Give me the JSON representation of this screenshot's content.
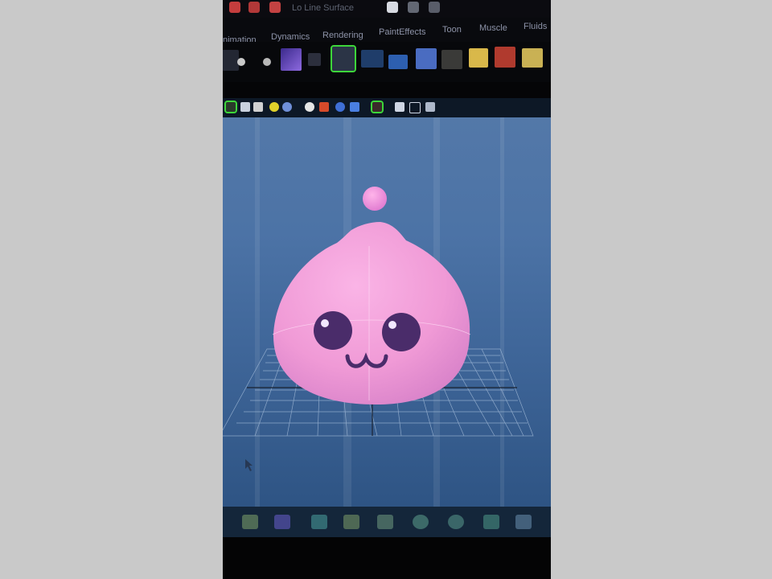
{
  "app": {
    "title": "Lo Line Surface"
  },
  "menu_tabs": [
    {
      "label": "nimation"
    },
    {
      "label": "Dynamics"
    },
    {
      "label": "Rendering"
    },
    {
      "label": "PaintEffects"
    },
    {
      "label": "Toon"
    },
    {
      "label": "Muscle"
    },
    {
      "label": "Fluids"
    }
  ],
  "shelf_icons": [
    "curve-tool-icon",
    "pivot-icon",
    "light-icon",
    "cube-icon",
    "camera-select-icon",
    "box-tool-icon",
    "plane-icon",
    "cube-blue-icon",
    "shader-icon",
    "paint-icon",
    "arrow-tool-icon",
    "move-tool-icon",
    "bevel-icon"
  ],
  "panel_icons": [
    "isolate-select-icon",
    "wireframe-icon",
    "smooth-shade-icon",
    "light-sphere-icon",
    "shaded-sphere-icon",
    "shadow-sphere-icon",
    "material-icon",
    "texture-icon",
    "blue-object-icon",
    "select-arrow-icon",
    "cube-outline-icon",
    "square-outline-icon",
    "node-graph-icon"
  ],
  "bottom_icons": [
    "render-icon",
    "bowtie-icon",
    "hair-icon",
    "paint-tool-icon",
    "cube-icon",
    "globe-icon",
    "ring-icon",
    "magnet-icon",
    "brush-icon"
  ],
  "colors": {
    "accent_select": "#3dd63a",
    "viewport_top": "#5378a8",
    "viewport_bottom": "#2e5484",
    "model_pink": "#f59bd8",
    "grid_line": "#a9c0dc"
  }
}
